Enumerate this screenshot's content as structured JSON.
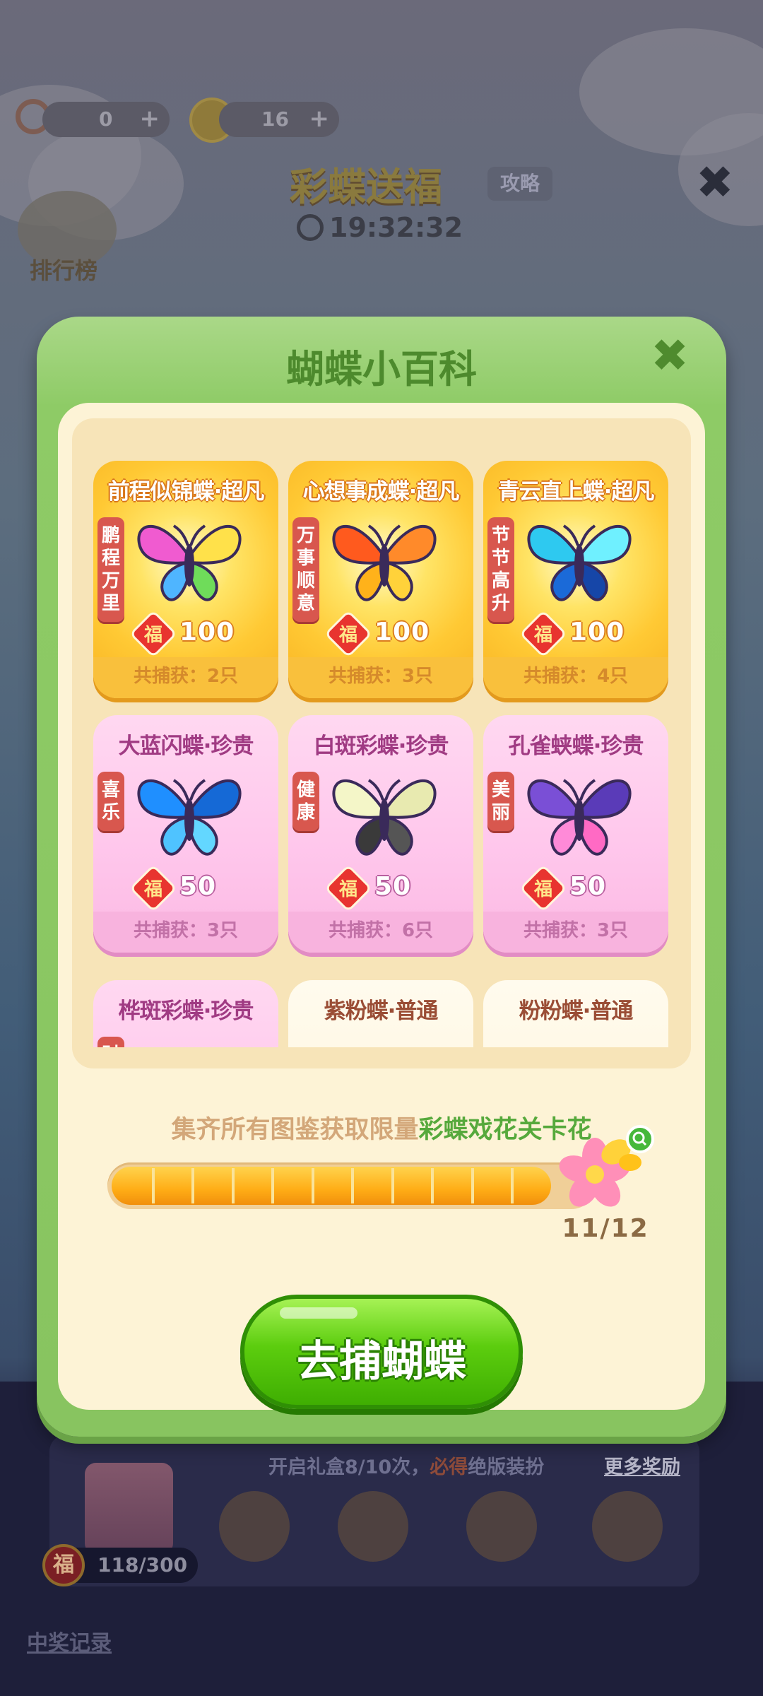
{
  "topbar": {
    "magnifier_count": "0",
    "coin_count": "16",
    "plus": "+"
  },
  "game": {
    "title": "彩蝶送福",
    "strategy_label": "攻略",
    "close_label": "✖",
    "timer": "19:32:32",
    "ranking_label": "排行榜"
  },
  "modal": {
    "title": "蝴蝶小百科",
    "close_label": "✖"
  },
  "cards": [
    {
      "name": "前程似锦蝶·超凡",
      "tag": "鹏程万里",
      "fu_value": "100",
      "caught": "共捕获：2只",
      "rarity": "gold"
    },
    {
      "name": "心想事成蝶·超凡",
      "tag": "万事顺意",
      "fu_value": "100",
      "caught": "共捕获：3只",
      "rarity": "gold"
    },
    {
      "name": "青云直上蝶·超凡",
      "tag": "节节高升",
      "fu_value": "100",
      "caught": "共捕获：4只",
      "rarity": "gold"
    },
    {
      "name": "大蓝闪蝶·珍贵",
      "tag": "喜乐",
      "fu_value": "50",
      "caught": "共捕获：3只",
      "rarity": "pink"
    },
    {
      "name": "白斑彩蝶·珍贵",
      "tag": "健康",
      "fu_value": "50",
      "caught": "共捕获：6只",
      "rarity": "pink"
    },
    {
      "name": "孔雀蛱蝶·珍贵",
      "tag": "美丽",
      "fu_value": "50",
      "caught": "共捕获：3只",
      "rarity": "pink"
    },
    {
      "name": "桦斑彩蝶·珍贵",
      "tag": "财",
      "rarity": "pink"
    },
    {
      "name": "紫粉蝶·普通",
      "rarity": "cream"
    },
    {
      "name": "粉粉蝶·普通",
      "rarity": "cream"
    }
  ],
  "fu_char": "福",
  "collection": {
    "text_prefix": "集齐所有图鉴获取限量",
    "text_highlight": "彩蝶戏花关卡花",
    "progress_current": 11,
    "progress_total": 12,
    "progress_label": "11/12"
  },
  "go_button_label": "去捕蝴蝶",
  "bottom": {
    "strip_text_prefix": "开启礼盒8/10次，",
    "strip_text_bold": "必得",
    "strip_text_suffix": "绝版装扮",
    "more_rewards_label": "更多奖励",
    "fu_progress": "118/300",
    "records_label": "中奖记录"
  },
  "colors": {
    "modal_green": "#8ecb66",
    "gold_card": "#ffc934",
    "pink_card": "#ffc7ec",
    "go_button": "#5ccd0e"
  }
}
